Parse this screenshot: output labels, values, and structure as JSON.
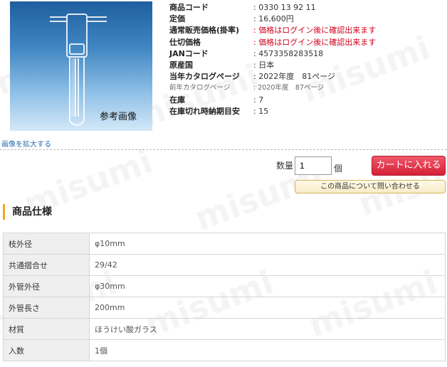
{
  "image": {
    "caption": "参考画像",
    "zoom_link": "画像を拡大する"
  },
  "product_info": [
    {
      "label": "商品コード",
      "value": ": 0330 13 92 11",
      "style": "normal"
    },
    {
      "label": "定価",
      "value": ": 16,600円",
      "style": "normal"
    },
    {
      "label": "通常販売価格(掛率)",
      "value": ": 価格はログイン後に確認出来ます",
      "style": "red"
    },
    {
      "label": "仕切価格",
      "value": ": 価格はログイン後に確認出来ます",
      "style": "red"
    },
    {
      "label": "JANコード",
      "value": ": 4573358283518",
      "style": "normal"
    },
    {
      "label": "原産国",
      "value": ": 日本",
      "style": "normal"
    },
    {
      "label": "当年カタログページ",
      "value": ": 2022年度　81ページ",
      "style": "normal"
    },
    {
      "label": "前年カタログページ",
      "value": ": 2020年度　87ページ",
      "style": "small"
    },
    {
      "label": "在庫",
      "value": ": 7",
      "style": "normal"
    },
    {
      "label": "在庫切れ時納期目安",
      "value": ": 15",
      "style": "normal"
    }
  ],
  "order": {
    "qty_label": "数量",
    "qty_value": "1",
    "qty_unit": "個",
    "cart_button": "カートに入れる",
    "inquiry_button": "この商品について問い合わせる"
  },
  "specs_section": {
    "title": "商品仕様",
    "rows": [
      {
        "label": "枝外径",
        "value": "φ10mm"
      },
      {
        "label": "共通摺合せ",
        "value": "29/42"
      },
      {
        "label": "外管外径",
        "value": "φ30mm"
      },
      {
        "label": "外管長さ",
        "value": "200mm"
      },
      {
        "label": "材質",
        "value": "ほうけい酸ガラス"
      },
      {
        "label": "入数",
        "value": "1個"
      }
    ]
  },
  "watermark_text": "misumi",
  "colors": {
    "accent_red": "#d0021b",
    "cart_button": "#d41f37",
    "section_accent": "#f5a623",
    "link_blue": "#2a6db0"
  },
  "icons": [
    "product-image",
    "glass-trap-illustration"
  ]
}
